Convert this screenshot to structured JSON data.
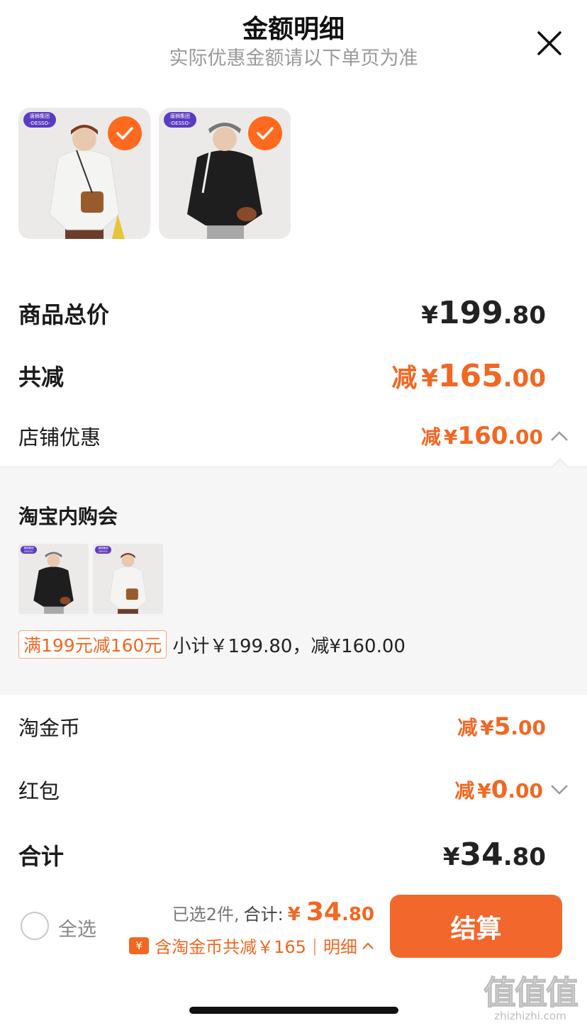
{
  "header": {
    "title": "金额明细",
    "subtitle": "实际优惠金额请以下单页为准"
  },
  "brand": {
    "top": "唐狮集团",
    "bottom": "-DESSO-"
  },
  "rows": {
    "total_price": {
      "label": "商品总价",
      "currency": "¥",
      "int": "199",
      "dec": ".80"
    },
    "total_discount": {
      "label": "共减",
      "prefix": "减",
      "currency": "¥",
      "int": "165",
      "dec": ".00"
    },
    "store_discount": {
      "label": "店铺优惠",
      "prefix": "减",
      "currency": "¥",
      "int": "160",
      "dec": ".00"
    },
    "coins": {
      "label": "淘金币",
      "prefix": "减",
      "currency": "¥",
      "int": "5",
      "dec": ".00"
    },
    "red_packet": {
      "label": "红包",
      "prefix": "减",
      "currency": "¥",
      "int": "0",
      "dec": ".00"
    },
    "sum": {
      "label": "合计",
      "currency": "¥",
      "int": "34",
      "dec": ".80"
    }
  },
  "panel": {
    "title": "淘宝内购会",
    "promo_tag": "满199元减160元",
    "promo_text": "小计￥199.80，减¥160.00"
  },
  "bottom": {
    "select_all": "全选",
    "selected": "已选2件,",
    "sum_label": "合计:",
    "currency": "¥",
    "sum_int": "34",
    "sum_dec": ".80",
    "coin_icon": "¥",
    "discount_note": "含淘金币共减￥165",
    "separator": "|",
    "detail": "明细",
    "checkout": "结算"
  },
  "watermark": {
    "big": "值值值",
    "small": "zhizhizhi.com"
  },
  "colors": {
    "accent": "#f26722",
    "checkout": "#f2672b",
    "panel_bg": "#f6f6f6"
  }
}
